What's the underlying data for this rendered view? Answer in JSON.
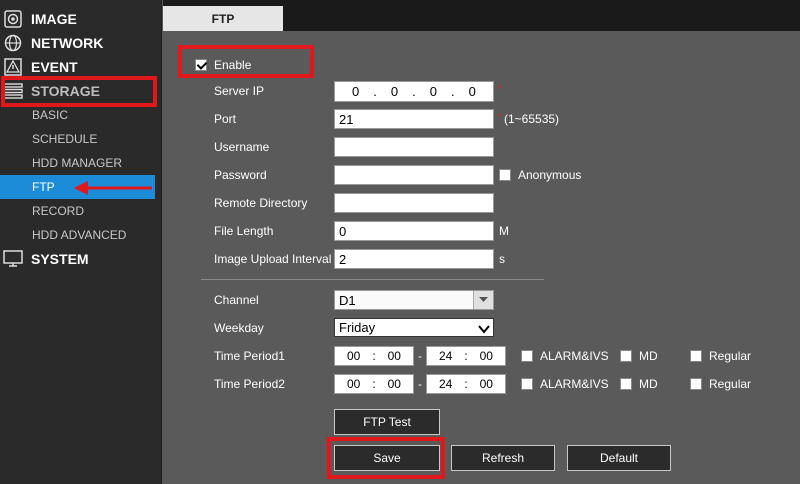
{
  "sidebar": {
    "image": "IMAGE",
    "network": "NETWORK",
    "event": "EVENT",
    "storage": "STORAGE",
    "sub": [
      "BASIC",
      "SCHEDULE",
      "HDD MANAGER",
      "FTP",
      "RECORD",
      "HDD ADVANCED"
    ],
    "system": "SYSTEM"
  },
  "tab": {
    "label": "FTP"
  },
  "form": {
    "enable_label": "Enable",
    "server_ip_label": "Server IP",
    "ip": [
      "0",
      "0",
      "0",
      "0"
    ],
    "port_label": "Port",
    "port_value": "21",
    "port_range": "(1~65535)",
    "username_label": "Username",
    "username_value": "",
    "password_label": "Password",
    "password_value": "",
    "anonymous_label": "Anonymous",
    "remote_dir_label": "Remote Directory",
    "remote_dir_value": "",
    "file_length_label": "File Length",
    "file_length_value": "0",
    "file_length_unit": "M",
    "upload_interval_label": "Image Upload Interval",
    "upload_interval_value": "2",
    "upload_interval_unit": "s",
    "channel_label": "Channel",
    "channel_value": "D1",
    "weekday_label": "Weekday",
    "weekday_value": "Friday",
    "tp1_label": "Time Period1",
    "tp2_label": "Time Period2",
    "tp_start": [
      "00",
      "00"
    ],
    "tp_end": [
      "24",
      "00"
    ],
    "alarm_label": "ALARM&IVS",
    "md_label": "MD",
    "regular_label": "Regular",
    "dash": "-",
    "colon": ":",
    "ip_dot": "."
  },
  "buttons": {
    "ftp_test": "FTP Test",
    "save": "Save",
    "refresh": "Refresh",
    "default": "Default"
  },
  "colors": {
    "active_blue": "#1c8cd8",
    "highlight_red": "#e0171b"
  }
}
